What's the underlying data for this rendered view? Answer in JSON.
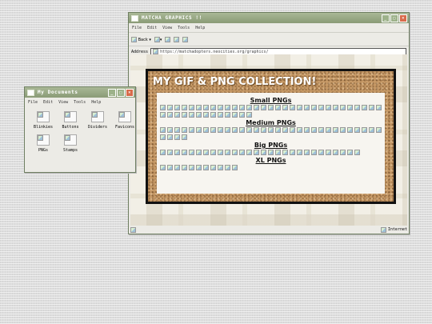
{
  "browser": {
    "title": "MATCHA GRAPHICS !!",
    "menu": [
      "File",
      "Edit",
      "View",
      "Tools",
      "Help"
    ],
    "back_label": "Back",
    "address_label": "Address",
    "url": "https://matchadopters.neocities.org/graphics/",
    "status": "Internet",
    "page": {
      "heading": "MY GIF & PNG COLLECTION!",
      "sections": [
        {
          "title": "Small PNGs",
          "count": 44
        },
        {
          "title": "Medium PNGs",
          "count": 35
        },
        {
          "title": "Big PNGs",
          "count": 28
        },
        {
          "title": "XL PNGs",
          "count": 11
        }
      ]
    }
  },
  "explorer": {
    "title": "My Documents",
    "menu": [
      "File",
      "Edit",
      "View",
      "Tools",
      "Help"
    ],
    "folders": [
      "Blinkies",
      "Buttons",
      "Dividers",
      "Favicons",
      "PNGs",
      "Stamps"
    ]
  },
  "colors": {
    "titlebar": "#8a9b76",
    "close": "#d86b4b",
    "cork": "#c79a67"
  }
}
